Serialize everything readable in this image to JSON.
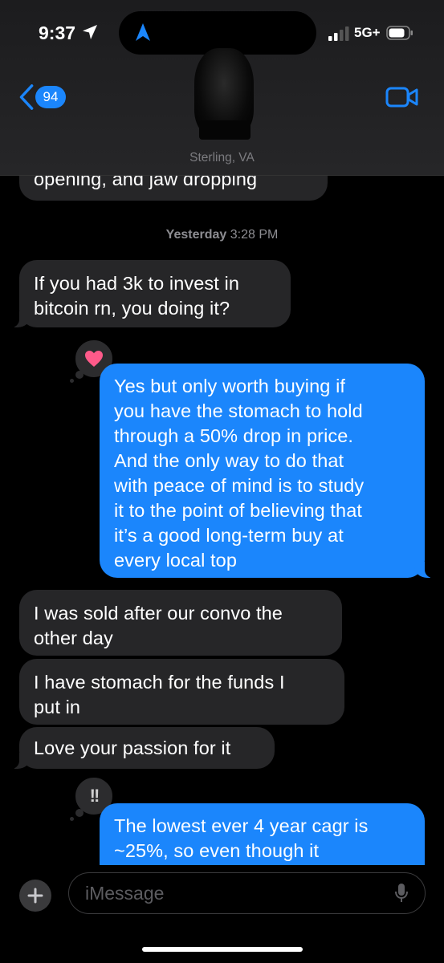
{
  "status_bar": {
    "time": "9:37",
    "network": "5G+"
  },
  "header": {
    "back_badge": "94",
    "contact_location": "Sterling, VA",
    "back_icon": "chevron-left-icon",
    "video_icon": "video-camera-icon"
  },
  "messages": {
    "partial_top": "opening, and jaw dropping",
    "timestamp_day": "Yesterday",
    "timestamp_time": "3:28 PM",
    "m1": [
      "If you had 3k to invest in",
      "bitcoin rn, you doing it?"
    ],
    "m2": [
      "Yes but only worth buying if",
      "you have the stomach to hold",
      "through a 50% drop in price.",
      "And the only way to do that",
      "with peace of mind is to study",
      "it to the point of believing that",
      "it’s a good long-term buy at",
      "every local top"
    ],
    "m2_tapback": "heart",
    "m3": [
      "I was sold after our convo the",
      "other day"
    ],
    "m4": [
      "I have stomach for the funds I",
      "put in"
    ],
    "m5": "Love your passion for it",
    "m6": [
      "The lowest ever 4 year cagr is",
      "~25%, so even though it"
    ],
    "m6_tapback": "!!"
  },
  "composer": {
    "placeholder": "iMessage"
  },
  "colors": {
    "sent": "#1b86fc",
    "received": "#262628",
    "heart": "#ff5a8a"
  }
}
